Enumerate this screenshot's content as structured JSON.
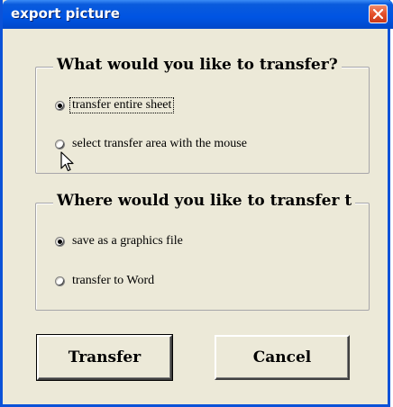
{
  "window": {
    "title": "export picture",
    "close_label": "close"
  },
  "group_transfer": {
    "title": "What would you like to transfer?",
    "options": [
      {
        "label": "transfer entire sheet",
        "checked": true
      },
      {
        "label": "select transfer area with the mouse",
        "checked": false
      }
    ]
  },
  "group_destination": {
    "title": "Where would you like to transfer t",
    "options": [
      {
        "label": "save as a graphics file",
        "checked": true
      },
      {
        "label": "transfer to Word",
        "checked": false
      }
    ]
  },
  "buttons": {
    "transfer_label": "Transfer",
    "cancel_label": "Cancel"
  },
  "icons": {
    "close": "close-icon",
    "cursor": "mouse-pointer-icon"
  },
  "colors": {
    "titlebar": "#0054e3",
    "dialog_background": "#ece9d8",
    "close_button": "#e5502a"
  }
}
